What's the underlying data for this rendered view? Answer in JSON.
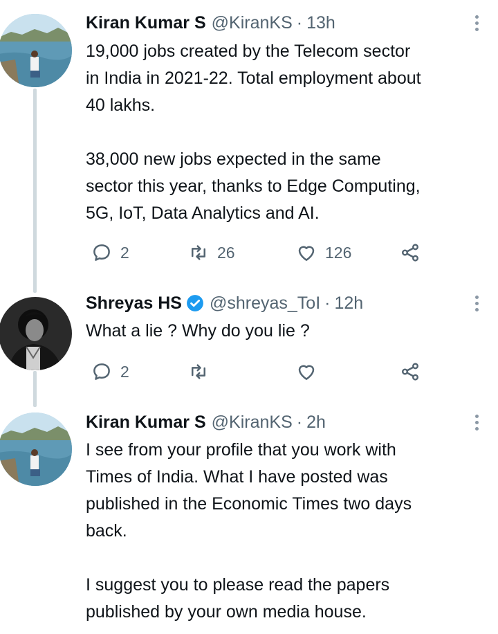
{
  "tweets": [
    {
      "name": "Kiran Kumar S",
      "handle": "@KiranKS",
      "separator": "·",
      "time": "13h",
      "verified": false,
      "avatar": "lake-landscape-photo",
      "paragraphs": [
        [
          "19,000 jobs created by the Telecom sector",
          "in India in 2021-22. Total employment about",
          "40 lakhs."
        ],
        [
          "38,000 new jobs expected in the same",
          "sector this year, thanks to Edge Computing,",
          "5G, IoT, Data Analytics and AI."
        ]
      ],
      "replies": "2",
      "retweets": "26",
      "likes": "126"
    },
    {
      "name": "Shreyas HS",
      "handle": "@shreyas_ToI",
      "separator": "·",
      "time": "12h",
      "verified": true,
      "avatar": "person-portrait-bw",
      "paragraphs": [
        [
          "What a lie ? Why do you lie ?"
        ]
      ],
      "replies": "2",
      "retweets": "",
      "likes": ""
    },
    {
      "name": "Kiran Kumar S",
      "handle": "@KiranKS",
      "separator": "·",
      "time": "2h",
      "verified": false,
      "avatar": "lake-landscape-photo",
      "paragraphs": [
        [
          "I see from your profile that you work with",
          "Times of India. What I have posted was",
          "published in the Economic Times two days",
          "back."
        ],
        [
          "I suggest you to please read the papers",
          "published by your own media house."
        ]
      ]
    }
  ],
  "colors": {
    "text": "#0f1419",
    "muted": "#536471",
    "verified": "#1d9bf0",
    "thread_line": "#cfd9de"
  },
  "icons": {
    "reply": "reply-icon",
    "retweet": "retweet-icon",
    "like": "heart-icon",
    "share": "share-icon",
    "more": "more-options-icon",
    "verified": "verified-badge-icon"
  }
}
